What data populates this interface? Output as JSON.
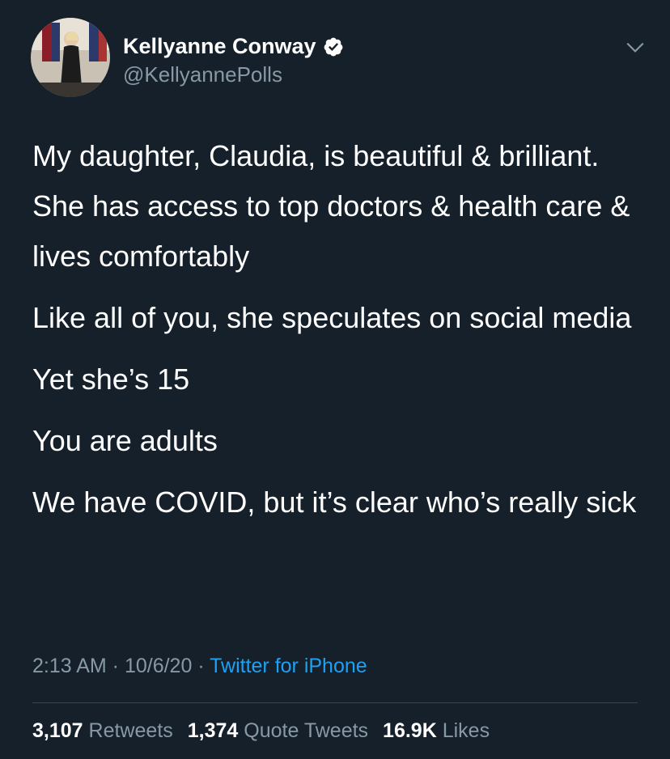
{
  "author": {
    "name": "Kellyanne Conway",
    "handle": "@KellyannePolls",
    "verified_icon": "verified-badge-icon"
  },
  "tweet": {
    "paragraphs": [
      "My daughter, Claudia, is beautiful & brilliant. She has access to top doctors & health care & lives comfortably",
      "Like all of you, she speculates on social media",
      "Yet she’s 15",
      "You are adults",
      "We have COVID, but it’s clear who’s really sick"
    ]
  },
  "meta": {
    "time": "2:13 AM",
    "sep1": " · ",
    "date": "10/6/20",
    "sep2": " · ",
    "source": "Twitter for iPhone"
  },
  "stats": {
    "retweets_count": "3,107",
    "retweets_label": "Retweets",
    "quotes_count": "1,374",
    "quotes_label": "Quote Tweets",
    "likes_count": "16.9K",
    "likes_label": "Likes"
  },
  "colors": {
    "background": "#15202b",
    "secondary_text": "#8899a6",
    "link": "#1da1f2"
  }
}
